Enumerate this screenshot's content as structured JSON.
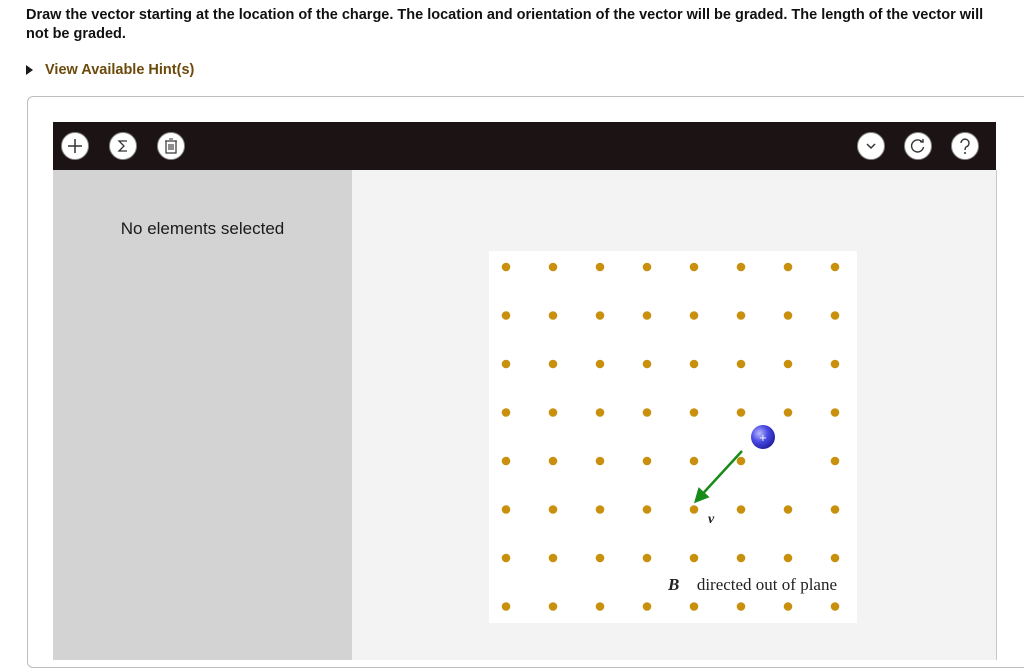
{
  "instructions": "Draw the vector starting at the location of the charge. The location and orientation of the vector will be graded. The length of the vector will not be graded.",
  "hint_link": "View Available Hint(s)",
  "toolbar": {
    "add_icon": "plus-icon",
    "sigma_icon": "sigma-icon",
    "delete_icon": "trash-icon",
    "dropdown_icon": "chevron-down-icon",
    "reset_icon": "reset-icon",
    "help_icon": "question-mark-icon"
  },
  "side_panel": {
    "status": "No elements selected"
  },
  "figure": {
    "grid": {
      "rows": 8,
      "cols": 8,
      "dot_color": "#c8900c"
    },
    "charge": {
      "symbol": "+",
      "color": "#3b3be0",
      "row": 4,
      "col": 6
    },
    "velocity": {
      "color": "#178a17"
    },
    "velocity_label": "v⃗",
    "field_label_symbol": "B⃗",
    "field_label_text": " directed out of plane"
  }
}
